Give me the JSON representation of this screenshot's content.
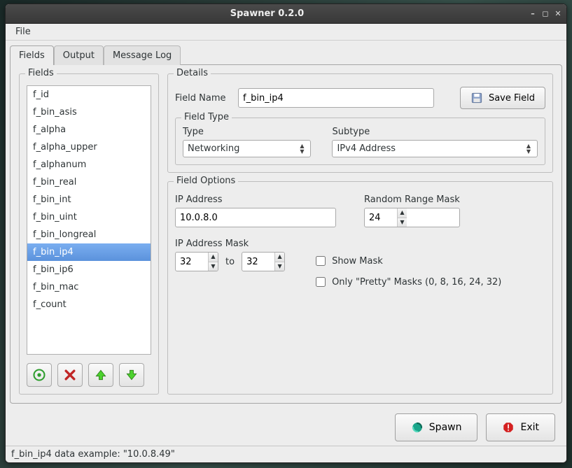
{
  "window": {
    "title": "Spawner 0.2.0"
  },
  "menubar": {
    "file": "File"
  },
  "tabs": [
    {
      "id": "fields",
      "label": "Fields",
      "active": true
    },
    {
      "id": "output",
      "label": "Output",
      "active": false
    },
    {
      "id": "msglog",
      "label": "Message Log",
      "active": false
    }
  ],
  "fields_panel": {
    "legend": "Fields",
    "items": [
      "f_id",
      "f_bin_asis",
      "f_alpha",
      "f_alpha_upper",
      "f_alphanum",
      "f_bin_real",
      "f_bin_int",
      "f_bin_uint",
      "f_bin_longreal",
      "f_bin_ip4",
      "f_bin_ip6",
      "f_bin_mac",
      "f_count"
    ],
    "selected_index": 9
  },
  "details": {
    "legend": "Details",
    "field_name_label": "Field Name",
    "field_name_value": "f_bin_ip4",
    "save_label": "Save Field",
    "field_type": {
      "legend": "Field Type",
      "type_label": "Type",
      "type_value": "Networking",
      "subtype_label": "Subtype",
      "subtype_value": "IPv4 Address"
    },
    "field_options": {
      "legend": "Field Options",
      "ip_address_label": "IP Address",
      "ip_address_value": "10.0.8.0",
      "random_mask_label": "Random Range Mask",
      "random_mask_value": "24",
      "ip_mask_label": "IP Address Mask",
      "ip_mask_from": "32",
      "ip_mask_to_label": "to",
      "ip_mask_to": "32",
      "show_mask_label": "Show Mask",
      "show_mask_checked": false,
      "pretty_masks_label": "Only \"Pretty\" Masks (0, 8, 16, 24, 32)",
      "pretty_masks_checked": false
    }
  },
  "bottom": {
    "spawn_label": "Spawn",
    "exit_label": "Exit"
  },
  "statusbar": "f_bin_ip4 data example: \"10.0.8.49\""
}
